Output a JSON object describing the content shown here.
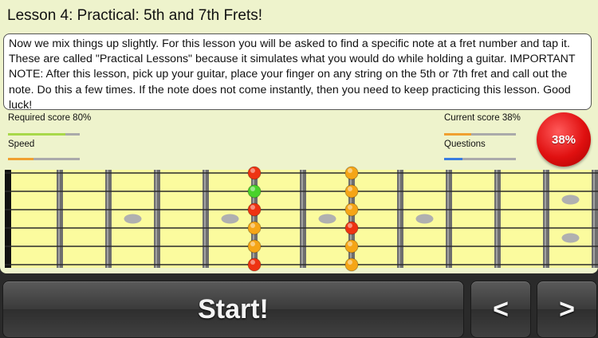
{
  "lesson": {
    "title": "Lesson 4: Practical: 5th and 7th Frets!",
    "description": "Now we mix things up slightly. For this lesson you will be asked to find a specific note at a fret number and tap it. These are called \"Practical Lessons\" because it simulates what you would do while holding a guitar. IMPORTANT NOTE: After this lesson, pick up your guitar, place your finger on any string on the 5th or 7th fret and call out the note. Do this a few times. If the note does not come instantly, then you need to keep practicing this lesson. Good luck!"
  },
  "stats": {
    "required_score_label": "Required score 80%",
    "required_score_fraction": 0.8,
    "speed_label": "Speed",
    "speed_fraction": 0.35,
    "current_score_label": "Current score 38%",
    "current_score_fraction": 0.38,
    "questions_label": "Questions",
    "questions_fraction": 0.25,
    "score_badge": "38%"
  },
  "colors": {
    "panel": "#eef3cc",
    "fretboard": "#fbfb9e",
    "required_bar": "#a8d84a",
    "speed_bar": "#f0a030",
    "score_bar": "#f0a030",
    "questions_bar": "#3a7de0",
    "badge": "#e01010",
    "marker_red": "#ee3312",
    "marker_green": "#48d22a",
    "marker_orange": "#f5a516"
  },
  "fretboard": {
    "strings": 6,
    "frets": 12,
    "markers": [
      {
        "fret": 5,
        "string": 1,
        "color": "red"
      },
      {
        "fret": 5,
        "string": 2,
        "color": "green"
      },
      {
        "fret": 5,
        "string": 3,
        "color": "red"
      },
      {
        "fret": 5,
        "string": 4,
        "color": "orange"
      },
      {
        "fret": 5,
        "string": 5,
        "color": "orange"
      },
      {
        "fret": 5,
        "string": 6,
        "color": "red"
      },
      {
        "fret": 7,
        "string": 1,
        "color": "orange"
      },
      {
        "fret": 7,
        "string": 2,
        "color": "orange"
      },
      {
        "fret": 7,
        "string": 3,
        "color": "orange"
      },
      {
        "fret": 7,
        "string": 4,
        "color": "red"
      },
      {
        "fret": 7,
        "string": 5,
        "color": "orange"
      },
      {
        "fret": 7,
        "string": 6,
        "color": "orange"
      }
    ],
    "inlays": [
      3,
      5,
      7,
      9,
      12
    ]
  },
  "controls": {
    "start_label": "Start!",
    "prev_label": "<",
    "next_label": ">"
  }
}
